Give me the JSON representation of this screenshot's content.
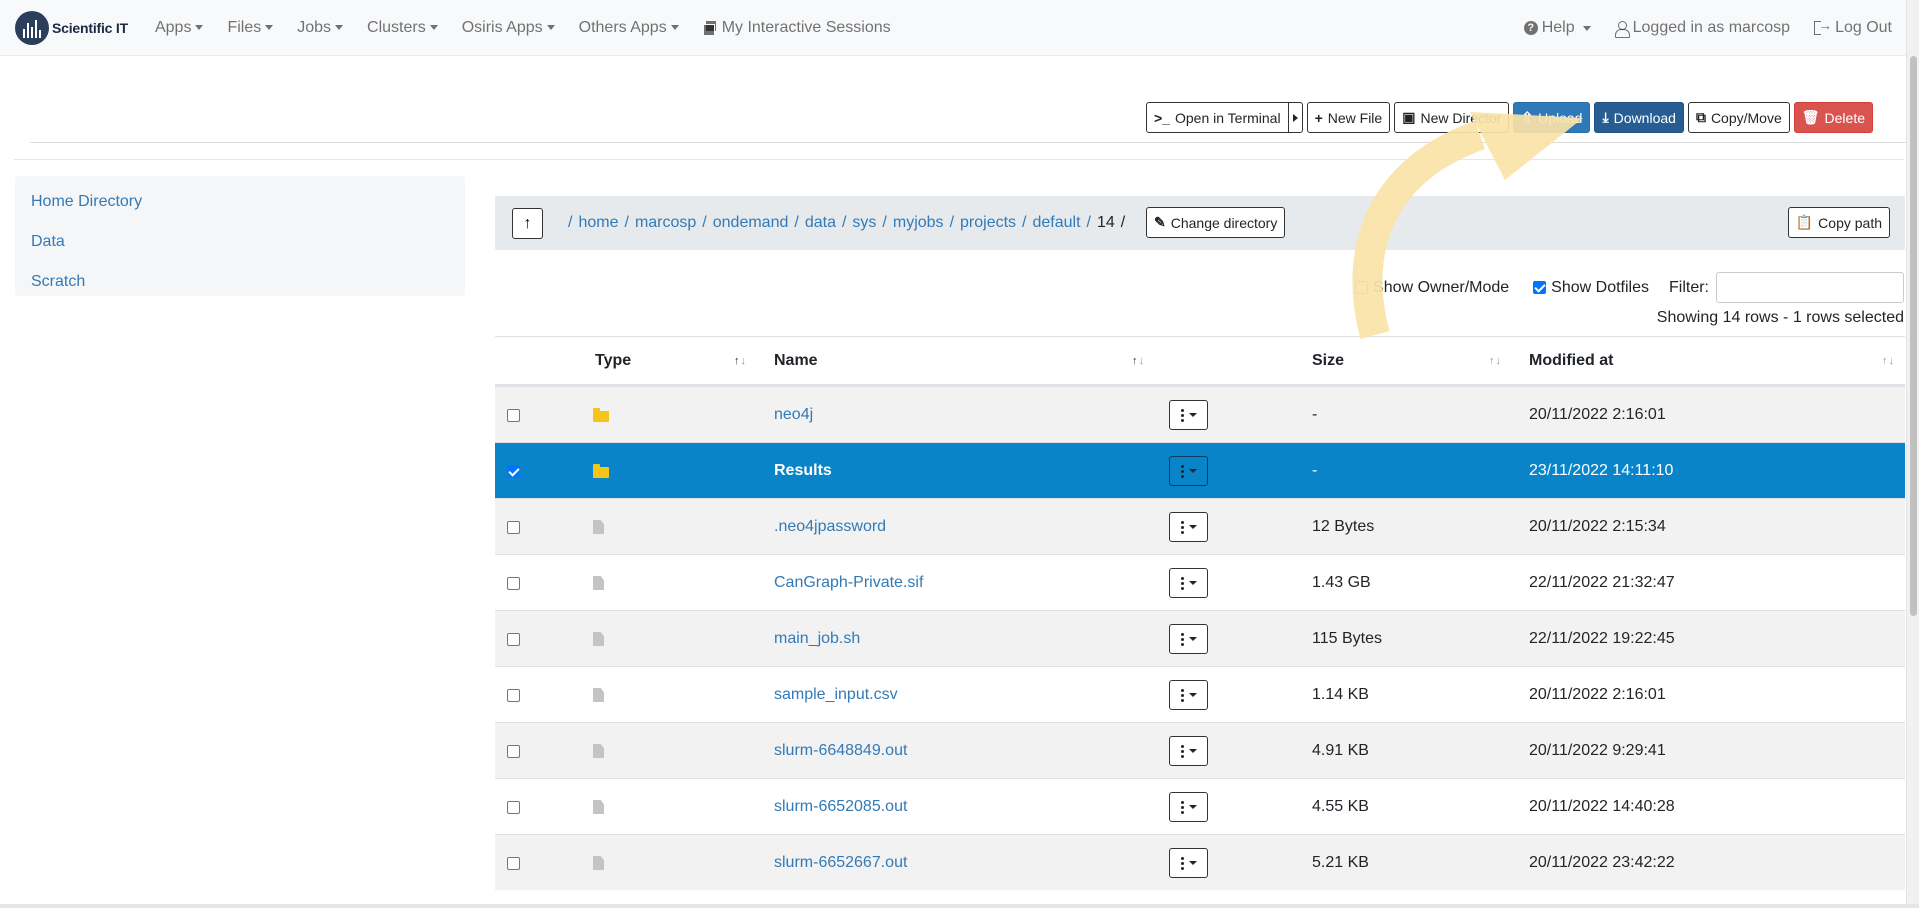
{
  "brand": {
    "name": "Scientific IT",
    "logo_icon": "scientific-it-logo-icon"
  },
  "nav": {
    "items": [
      {
        "label": "Apps"
      },
      {
        "label": "Files"
      },
      {
        "label": "Jobs"
      },
      {
        "label": "Clusters"
      },
      {
        "label": "Osiris Apps"
      },
      {
        "label": "Others Apps"
      }
    ],
    "sessions_label": "My Interactive Sessions",
    "help_label": "Help",
    "user_label": "Logged in as marcosp",
    "logout_label": "Log Out"
  },
  "toolbar": {
    "terminal_label": "Open in Terminal",
    "new_file_label": "New File",
    "new_dir_label": "New Director",
    "upload_label": "Upload",
    "download_label": "Download",
    "copy_move_label": "Copy/Move",
    "delete_label": "Delete"
  },
  "sidebar": {
    "items": [
      {
        "label": "Home Directory"
      },
      {
        "label": "Data"
      },
      {
        "label": "Scratch"
      }
    ]
  },
  "breadcrumb": {
    "root_sep": "/",
    "parts": [
      "home",
      "marcosp",
      "ondemand",
      "data",
      "sys",
      "myjobs",
      "projects",
      "default"
    ],
    "current": "14",
    "change_dir_label": "Change directory",
    "copy_path_label": "Copy path"
  },
  "options": {
    "owner_mode_label": "Show Owner/Mode",
    "owner_mode_checked": false,
    "dotfiles_label": "Show Dotfiles",
    "dotfiles_checked": true,
    "filter_label": "Filter:",
    "filter_value": ""
  },
  "status": {
    "showing": "Showing 14 rows - 1 rows selected"
  },
  "table": {
    "headers": {
      "type": "Type",
      "name": "Name",
      "size": "Size",
      "modified": "Modified at"
    },
    "rows": [
      {
        "type": "folder",
        "name": "neo4j",
        "size": "-",
        "modified": "20/11/2022 2:16:01",
        "selected": false
      },
      {
        "type": "folder",
        "name": "Results",
        "size": "-",
        "modified": "23/11/2022 14:11:10",
        "selected": true
      },
      {
        "type": "file",
        "name": ".neo4jpassword",
        "size": "12 Bytes",
        "modified": "20/11/2022 2:15:34",
        "selected": false
      },
      {
        "type": "file",
        "name": "CanGraph-Private.sif",
        "size": "1.43 GB",
        "modified": "22/11/2022 21:32:47",
        "selected": false
      },
      {
        "type": "file",
        "name": "main_job.sh",
        "size": "115 Bytes",
        "modified": "22/11/2022 19:22:45",
        "selected": false
      },
      {
        "type": "file",
        "name": "sample_input.csv",
        "size": "1.14 KB",
        "modified": "20/11/2022 2:16:01",
        "selected": false
      },
      {
        "type": "file",
        "name": "slurm-6648849.out",
        "size": "4.91 KB",
        "modified": "20/11/2022 9:29:41",
        "selected": false
      },
      {
        "type": "file",
        "name": "slurm-6652085.out",
        "size": "4.55 KB",
        "modified": "20/11/2022 14:40:28",
        "selected": false
      },
      {
        "type": "file",
        "name": "slurm-6652667.out",
        "size": "5.21 KB",
        "modified": "20/11/2022 23:42:22",
        "selected": false
      }
    ]
  },
  "colors": {
    "primary": "#2f79b8",
    "download": "#265e93",
    "danger": "#d9534f",
    "selected_row": "#0a84c8",
    "annotation_arrow": "#fbe3a8"
  }
}
